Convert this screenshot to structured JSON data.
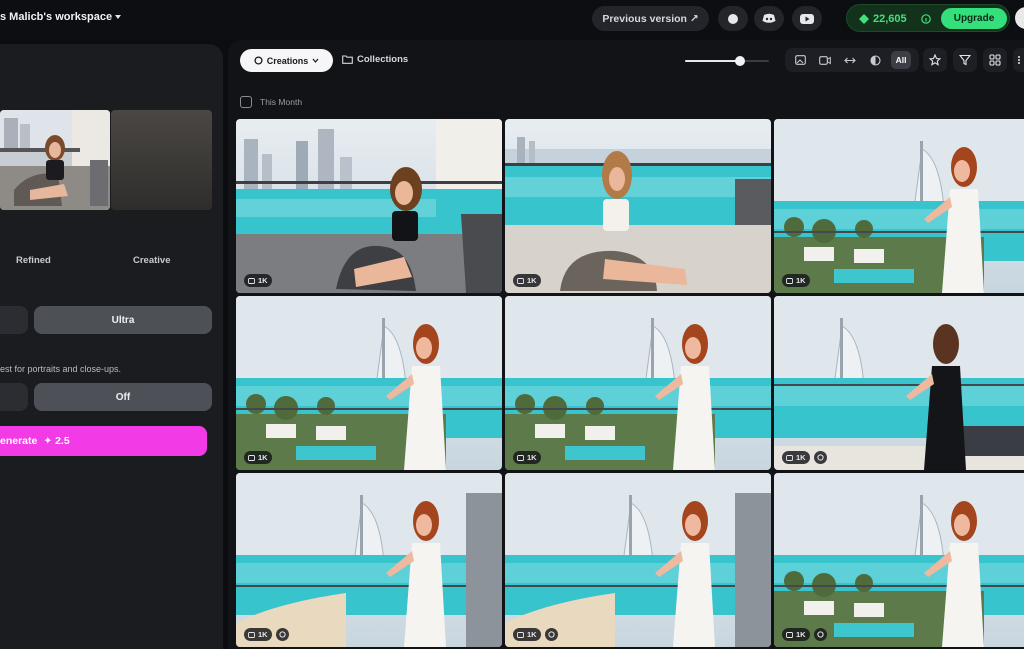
{
  "workspace": {
    "title": "s Malicb's workspace"
  },
  "header": {
    "previous_version": "Previous version ↗",
    "credits": "22,605",
    "upgrade": "Upgrade"
  },
  "left": {
    "modes": [
      "Refined",
      "Creative"
    ],
    "quality": "Ultra",
    "hint": "est for portraits and close-ups.",
    "toggle": "Off",
    "generate": "enerate",
    "generate_cost": "✦ 2.5"
  },
  "toolbar": {
    "creations": "Creations",
    "collections": "Collections",
    "zoom_level": 0.65,
    "view_all": "All"
  },
  "gallery": {
    "section": "This Month",
    "tiles": [
      {
        "res": "1K",
        "scene": "skyline"
      },
      {
        "res": "1K",
        "scene": "terrace"
      },
      {
        "res": "1K",
        "scene": "burj-dress"
      },
      {
        "res": "1K",
        "scene": "burj-dress"
      },
      {
        "res": "1K",
        "scene": "burj-dress"
      },
      {
        "res": "1K",
        "scene": "burj-back"
      },
      {
        "res": "1K",
        "scene": "burj-sea"
      },
      {
        "res": "1K",
        "scene": "burj-sea"
      },
      {
        "res": "1K",
        "scene": "burj-dress"
      }
    ]
  },
  "colors": {
    "accent_green": "#34e07c",
    "generate_pink": "#f23be6"
  }
}
